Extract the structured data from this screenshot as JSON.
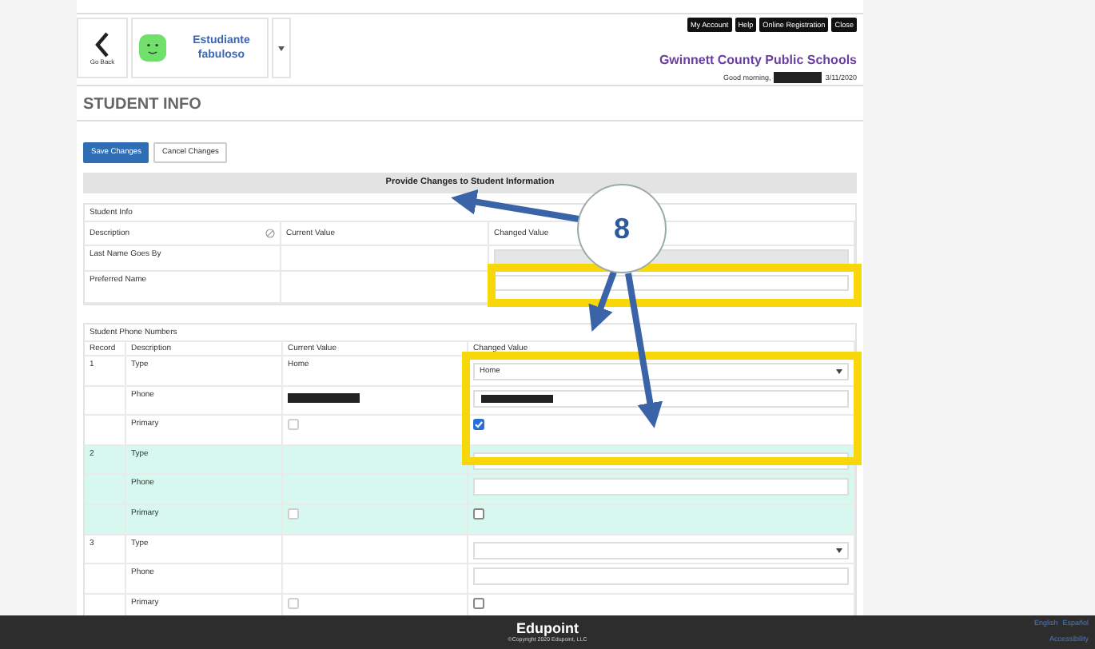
{
  "header": {
    "back_label": "Go Back",
    "student_name": "Estudiante fabuloso",
    "top_buttons": [
      "My Account",
      "Help",
      "Online Registration",
      "Close"
    ],
    "district": "Gwinnett County Public Schools",
    "greeting": "Good morning,",
    "date": "3/11/2020"
  },
  "page_title": "STUDENT INFO",
  "actions": [
    {
      "label": "Save Changes",
      "kind": "primary"
    },
    {
      "label": "Cancel Changes",
      "kind": "secondary"
    }
  ],
  "banner": "Provide Changes to Student Information",
  "student_info": {
    "title": "Student Info",
    "columns": [
      "Description",
      "Current Value",
      "Changed Value"
    ],
    "rows": [
      {
        "label": "Last Name Goes By",
        "disabled": true
      },
      {
        "label": "Preferred Name",
        "disabled": false
      }
    ]
  },
  "phones": {
    "title": "Student Phone Numbers",
    "columns": [
      "Record",
      "Description",
      "Current Value",
      "Changed Value"
    ],
    "records": [
      {
        "record": "1",
        "highlighted": false,
        "fields": [
          {
            "label": "Type",
            "kind": "select",
            "current": "Home",
            "value": "Home"
          },
          {
            "label": "Phone",
            "kind": "text",
            "redacted": true
          },
          {
            "label": "Primary",
            "kind": "checkbox",
            "current": false,
            "checked": true
          }
        ]
      },
      {
        "record": "2",
        "highlighted": true,
        "fields": [
          {
            "label": "Type",
            "kind": "select"
          },
          {
            "label": "Phone",
            "kind": "text",
            "redacted": false
          },
          {
            "label": "Primary",
            "kind": "checkbox",
            "current": false,
            "checked": false
          }
        ]
      },
      {
        "record": "3",
        "highlighted": false,
        "fields": [
          {
            "label": "Type",
            "kind": "select"
          },
          {
            "label": "Phone",
            "kind": "text",
            "redacted": false
          },
          {
            "label": "Primary",
            "kind": "checkbox",
            "current": false,
            "checked": false
          }
        ]
      }
    ]
  },
  "annotation": {
    "step": "8"
  },
  "footer": {
    "brand": "Edupoint",
    "copyright": "©Copyright 2020 Edupoint, LLC",
    "links": [
      "English",
      "Español"
    ],
    "accessibility": "Accessibility"
  }
}
